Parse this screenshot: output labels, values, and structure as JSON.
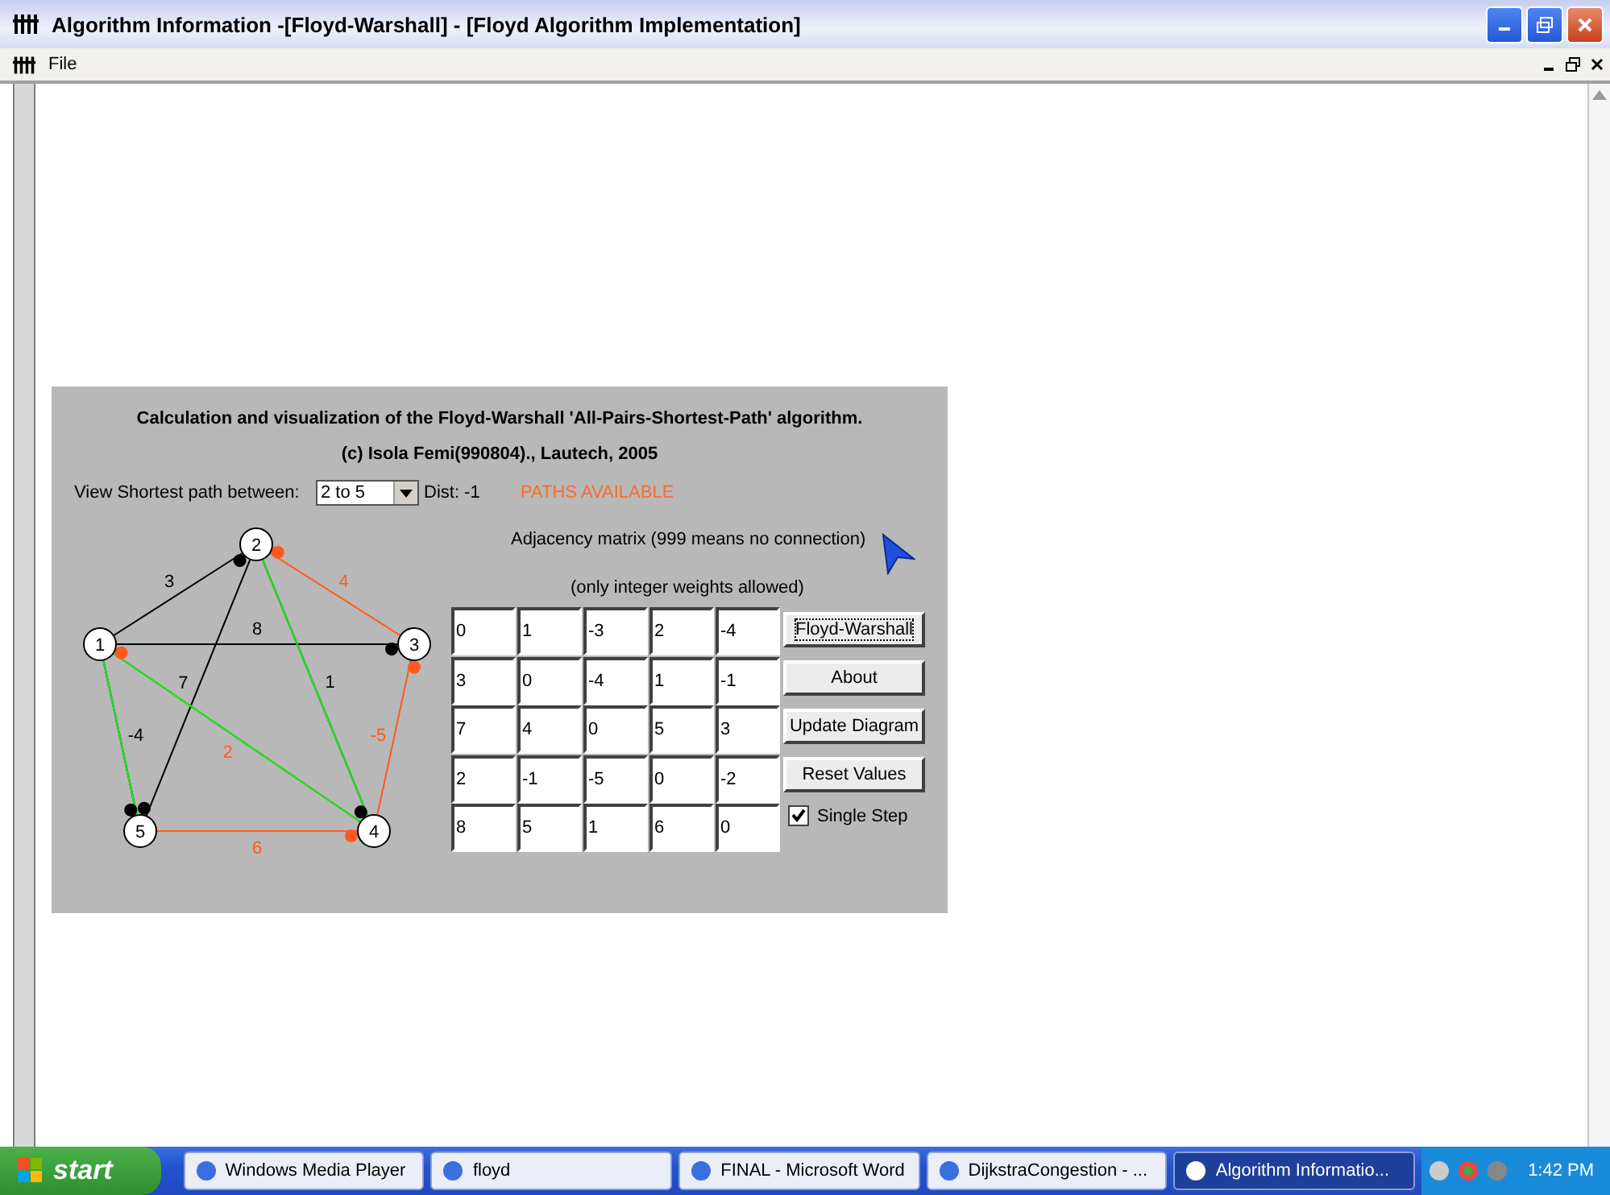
{
  "window": {
    "title": "Algorithm Information -[Floyd-Warshall] - [Floyd Algorithm Implementation]"
  },
  "menu_bar": {
    "items": [
      "File"
    ]
  },
  "panel": {
    "heading": "Calculation and visualization of the Floyd-Warshall 'All-Pairs-Shortest-Path' algorithm.",
    "credit": "(c)  Isola Femi(990804)., Lautech, 2005",
    "path_selector": {
      "label": "View Shortest path between:",
      "value": "2 to 5",
      "dist": "Dist: -1",
      "status": "PATHS AVAILABLE"
    },
    "graph": {
      "nodes": [
        "1",
        "2",
        "3",
        "4",
        "5"
      ],
      "edges": [
        {
          "label": "3",
          "color": "#000000",
          "on_path": false
        },
        {
          "label": "4",
          "color": "#ff5a1e",
          "on_path": false
        },
        {
          "label": "8",
          "color": "#000000",
          "on_path": false
        },
        {
          "label": "7",
          "color": "#000000",
          "on_path": false
        },
        {
          "label": "1",
          "color": "#000000",
          "on_path": true
        },
        {
          "label": "-4",
          "color": "#000000",
          "on_path": true
        },
        {
          "label": "2",
          "color": "#ff5a1e",
          "on_path": true
        },
        {
          "label": "-5",
          "color": "#ff5a1e",
          "on_path": false
        },
        {
          "label": "6",
          "color": "#ff5a1e",
          "on_path": false
        }
      ]
    },
    "matrix": {
      "caption": "Adjacency matrix (999 means no connection)",
      "note": "(only integer weights allowed)",
      "rows": [
        [
          "0",
          "1",
          "-3",
          "2",
          "-4"
        ],
        [
          "3",
          "0",
          "-4",
          "1",
          "-1"
        ],
        [
          "7",
          "4",
          "0",
          "5",
          "3"
        ],
        [
          "2",
          "-1",
          "-5",
          "0",
          "-2"
        ],
        [
          "8",
          "5",
          "1",
          "6",
          "0"
        ]
      ]
    },
    "buttons": [
      {
        "label": "Floyd-Warshall",
        "focused": true
      },
      {
        "label": "About",
        "focused": false
      },
      {
        "label": "Update Diagram",
        "focused": false
      },
      {
        "label": "Reset Values",
        "focused": false
      }
    ],
    "checkbox": {
      "label": "Single Step",
      "checked": true
    }
  },
  "taskbar": {
    "start": "start",
    "items": [
      {
        "label": "Windows Media Player",
        "active": false
      },
      {
        "label": "floyd",
        "active": false
      },
      {
        "label": "FINAL - Microsoft Word",
        "active": false
      },
      {
        "label": "DijkstraCongestion - ...",
        "active": false
      },
      {
        "label": "Algorithm Informatio...",
        "active": true
      }
    ],
    "clock": "1:42 PM"
  }
}
